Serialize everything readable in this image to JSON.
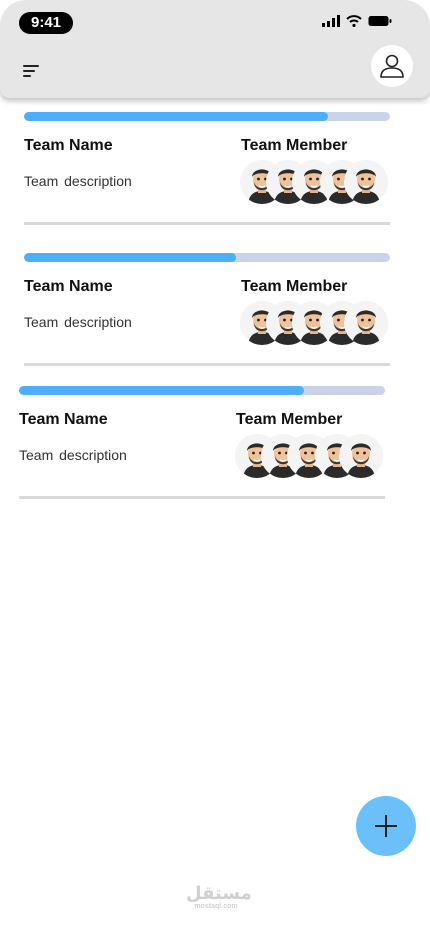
{
  "status": {
    "time": "9:41"
  },
  "header": {
    "menu_icon": "sort-lines-icon",
    "profile_icon": "user-icon"
  },
  "teams": [
    {
      "name": "Team Name",
      "member_label": "Team Member",
      "description": "Team  description",
      "progress": 0.83
    },
    {
      "name": "Team Name",
      "member_label": "Team Member",
      "description": "Team  description",
      "progress": 0.58
    },
    {
      "name": "Team Name",
      "member_label": "Team Member",
      "description": "Team  description",
      "progress": 0.78
    }
  ],
  "fab": {
    "icon": "plus-icon"
  },
  "watermark": {
    "arabic": "مستقل",
    "latin": "mostaql.com"
  },
  "colors": {
    "accent": "#4daefc",
    "track": "#c9d3ea",
    "fab": "#6cc0f9",
    "header_bg": "#e6e6e6"
  }
}
